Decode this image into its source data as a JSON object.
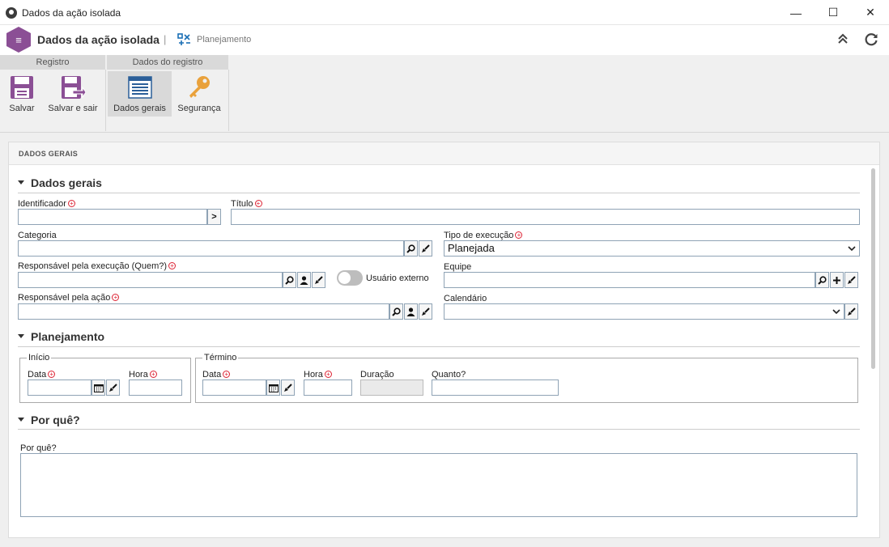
{
  "window": {
    "title": "Dados da ação isolada",
    "minimize": "—",
    "maximize": "☐",
    "close": "✕"
  },
  "header": {
    "title": "Dados da ação isolada",
    "separator": "|",
    "breadcrumb": "Planejamento",
    "icon_letter": "≡"
  },
  "ribbon": {
    "groups": [
      {
        "label": "Registro"
      },
      {
        "label": "Dados do registro"
      }
    ],
    "buttons": {
      "save": "Salvar",
      "save_exit": "Salvar e sair",
      "general": "Dados gerais",
      "security": "Segurança"
    }
  },
  "panel": {
    "title": "DADOS GERAIS",
    "sections": {
      "general": "Dados gerais",
      "planning": "Planejamento",
      "why": "Por quê?"
    }
  },
  "fields": {
    "identifier": {
      "label": "Identificador",
      "value": ""
    },
    "title": {
      "label": "Título",
      "value": ""
    },
    "category": {
      "label": "Categoria",
      "value": ""
    },
    "execution_type": {
      "label": "Tipo de execução",
      "value": "Planejada"
    },
    "responsible_exec": {
      "label": "Responsável pela execução (Quem?)",
      "value": ""
    },
    "external_user": {
      "label": "Usuário externo",
      "checked": false
    },
    "team": {
      "label": "Equipe",
      "value": ""
    },
    "responsible_action": {
      "label": "Responsável pela ação",
      "value": ""
    },
    "calendar": {
      "label": "Calendário",
      "value": ""
    },
    "start": {
      "legend": "Início",
      "date_label": "Data",
      "time_label": "Hora"
    },
    "end": {
      "legend": "Término",
      "date_label": "Data",
      "time_label": "Hora",
      "duration_label": "Duração",
      "cost_label": "Quanto?"
    },
    "why": {
      "label": "Por quê?",
      "value": ""
    }
  },
  "icons": {
    "search": "search-icon",
    "clear": "brush-icon",
    "user": "user-icon",
    "add": "plus-icon",
    "calendar": "calendar-icon",
    "arrow": "chevron-right-icon"
  },
  "colors": {
    "brand": "#8b4f95",
    "required": "#dd2233",
    "accent": "#1a6fb5"
  }
}
